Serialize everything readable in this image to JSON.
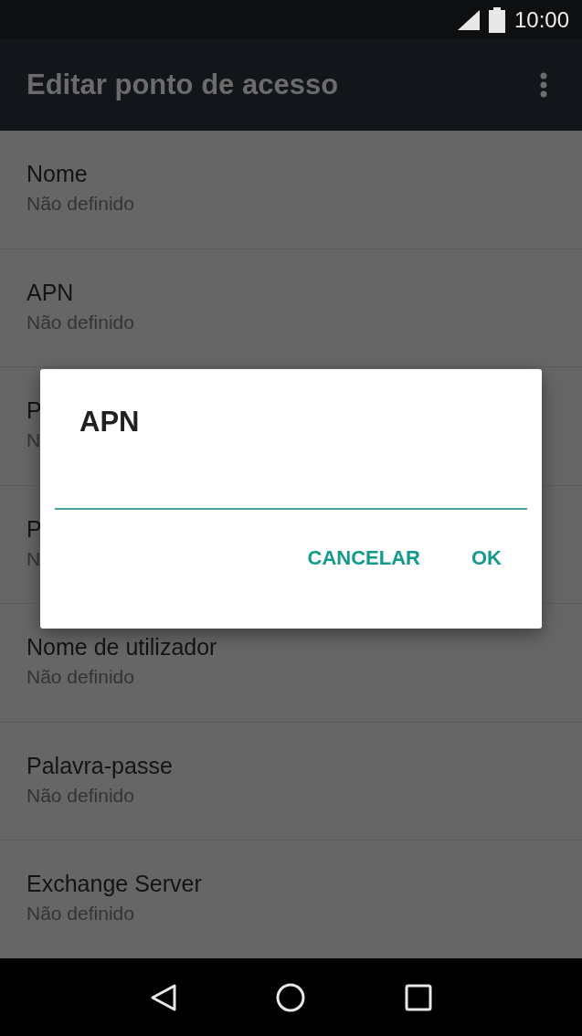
{
  "status_bar": {
    "time": "10:00"
  },
  "app_bar": {
    "title": "Editar ponto de acesso"
  },
  "settings": [
    {
      "title": "Nome",
      "value": "Não definido"
    },
    {
      "title": "APN",
      "value": "Não definido"
    },
    {
      "title": "P",
      "value": "N"
    },
    {
      "title": "P",
      "value": "N"
    },
    {
      "title": "Nome de utilizador",
      "value": "Não definido"
    },
    {
      "title": "Palavra-passe",
      "value": "Não definido"
    },
    {
      "title": "Exchange Server",
      "value": "Não definido"
    }
  ],
  "dialog": {
    "title": "APN",
    "buttons": [
      "CANCELAR",
      "OK"
    ]
  }
}
